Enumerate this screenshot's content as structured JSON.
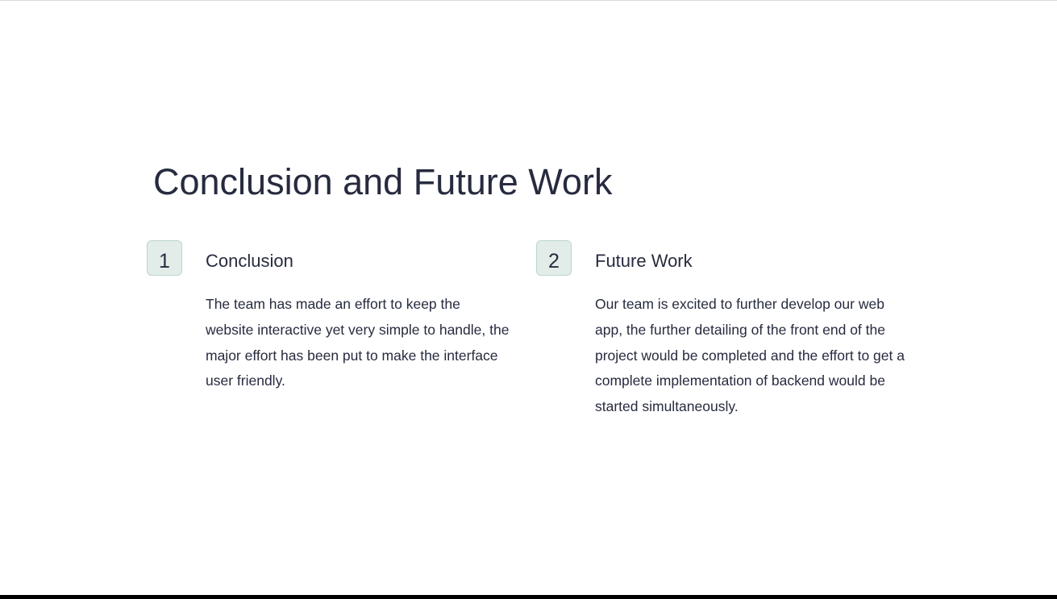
{
  "slide": {
    "title": "Conclusion and Future Work",
    "items": [
      {
        "number": "1",
        "heading": "Conclusion",
        "body": "The team has made an effort to keep the website interactive yet very simple to handle, the major effort has been put to make the interface user friendly."
      },
      {
        "number": "2",
        "heading": "Future Work",
        "body": "Our team is excited to further develop our web app, the further detailing of the front end of the project would be completed and the effort to get a complete implementation of backend would be started simultaneously."
      }
    ]
  },
  "colors": {
    "text": "#272b3f",
    "badge_fill": "#e2ece9",
    "badge_border": "#bcd6cf",
    "background": "#ffffff"
  }
}
